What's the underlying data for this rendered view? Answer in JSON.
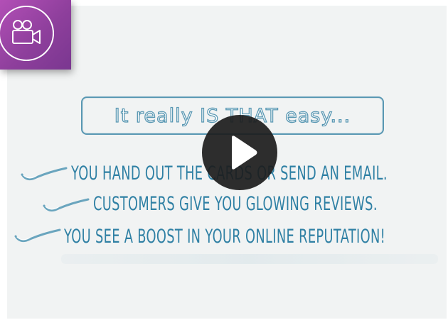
{
  "video": {
    "badge_icon": "video-camera-icon",
    "play_icon": "play-icon",
    "headline": "It really IS THAT easy...",
    "lines": [
      "YOU HAND OUT THE CARDS OR SEND AN EMAIL.",
      "CUSTOMERS GIVE YOU GLOWING REVIEWS.",
      "YOU SEE A BOOST IN YOUR ONLINE REPUTATION!"
    ],
    "check_icon": "checkmark-swoosh-icon"
  },
  "colors": {
    "badge": "#9c47a8",
    "text_blue": "#2f80a4",
    "outline_blue": "#5a98b3",
    "background": "#f1f3f3",
    "play_bg": "#1c1c1c"
  }
}
